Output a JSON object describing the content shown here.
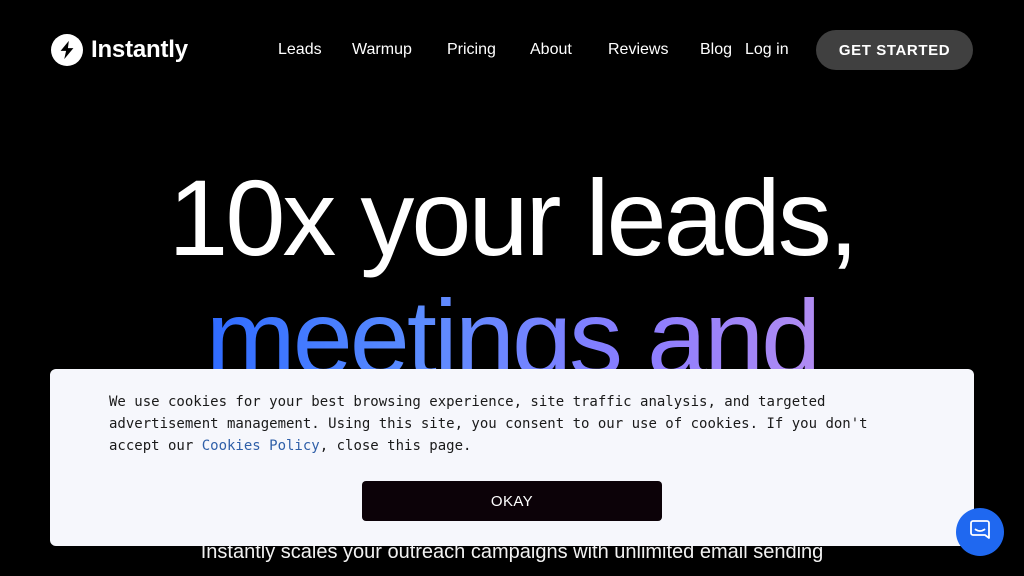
{
  "brand": {
    "name": "Instantly",
    "icon": "bolt-icon",
    "accent": "#2f6bff"
  },
  "nav": {
    "links": [
      {
        "label": "Leads"
      },
      {
        "label": "Warmup"
      },
      {
        "label": "Pricing"
      },
      {
        "label": "About"
      },
      {
        "label": "Reviews"
      },
      {
        "label": "Blog"
      }
    ],
    "login_label": "Log in",
    "cta_label": "GET STARTED"
  },
  "hero": {
    "line1": "10x your leads,",
    "line2": "meetings and",
    "subtitle": "Instantly scales your outreach campaigns with unlimited email sending"
  },
  "cookie_banner": {
    "text_before_link": "We use cookies for your best browsing experience, site traffic analysis, and targeted advertisement management. Using this site, you consent to our use of cookies. If you don't accept our ",
    "link_label": "Cookies Policy",
    "text_after_link": ", close this page.",
    "button_label": "OKAY"
  },
  "chat_widget": {
    "icon": "chat-bubble-icon",
    "color": "#1f68f0"
  }
}
